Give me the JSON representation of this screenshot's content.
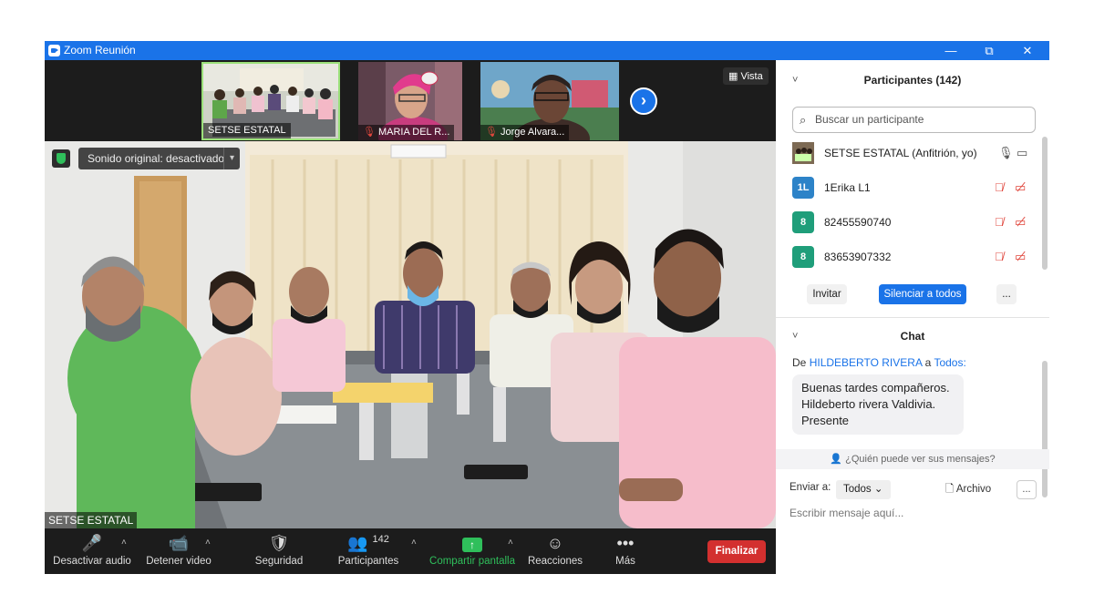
{
  "window": {
    "title": "Zoom Reunión",
    "controls": {
      "minimize": "—",
      "restore": "⧉",
      "close": "✕"
    }
  },
  "thumbnails": [
    {
      "label": "SETSE ESTATAL",
      "muted": false
    },
    {
      "label": "MARIA DEL R...",
      "muted": true
    },
    {
      "label": "Jorge Alvara...",
      "muted": true
    }
  ],
  "view_button": "Vista",
  "main_video": {
    "sound_badge": "Sonido original: desactivado",
    "speaker_label": "SETSE ESTATAL"
  },
  "toolbar": {
    "audio": "Desactivar audio",
    "video": "Detener video",
    "security": "Seguridad",
    "participants": "Participantes",
    "participants_count": "142",
    "share": "Compartir pantalla",
    "reactions": "Reacciones",
    "more": "Más",
    "end": "Finalizar"
  },
  "participants_panel": {
    "title": "Participantes (142)",
    "search_placeholder": "Buscar un participante",
    "list": [
      {
        "avatar": "",
        "name": "SETSE ESTATAL (Anfitrión, yo)",
        "color": "#6b5a45"
      },
      {
        "avatar": "1L",
        "name": "1Erika L1",
        "color": "#2d83c8"
      },
      {
        "avatar": "8",
        "name": "82455590740",
        "color": "#1f9e7a"
      },
      {
        "avatar": "8",
        "name": "83653907332",
        "color": "#1f9e7a"
      }
    ],
    "invite": "Invitar",
    "mute_all": "Silenciar a todos",
    "more": "..."
  },
  "chat": {
    "title": "Chat",
    "from_prefix": "De",
    "from_name": "HILDEBERTO RIVERA",
    "to_prefix": "a",
    "to_name": "Todos:",
    "message": "Buenas tardes compañeros. Hildeberto rivera Valdivia. Presente",
    "who_can_see": "¿Quién puede ver sus mensajes?",
    "send_to_label": "Enviar a:",
    "send_to_value": "Todos",
    "file": "Archivo",
    "more": "...",
    "input_placeholder": "Escribir mensaje aquí..."
  },
  "colors": {
    "accent": "#1a73e8",
    "end": "#d3302f",
    "share": "#2fbf5b",
    "muted": "#e0473d"
  }
}
